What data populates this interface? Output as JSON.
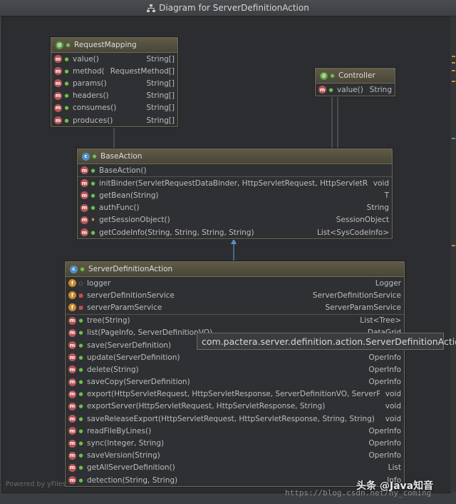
{
  "window": {
    "title": "Diagram for ServerDefinitionAction"
  },
  "classes": {
    "request_mapping": {
      "name": "RequestMapping",
      "kind_icon": "annotation-icon",
      "methods": [
        {
          "name": "value()",
          "type": "String[]"
        },
        {
          "name": "method()",
          "type": "RequestMethod[]"
        },
        {
          "name": "params()",
          "type": "String[]"
        },
        {
          "name": "headers()",
          "type": "String[]"
        },
        {
          "name": "consumes()",
          "type": "String[]"
        },
        {
          "name": "produces()",
          "type": "String[]"
        }
      ]
    },
    "controller": {
      "name": "Controller",
      "kind_icon": "annotation-icon",
      "methods": [
        {
          "name": "value()",
          "type": "String"
        }
      ]
    },
    "base_action": {
      "name": "BaseAction",
      "kind_icon": "class-icon",
      "constructors": [
        {
          "name": "BaseAction()",
          "type": ""
        }
      ],
      "methods": [
        {
          "name": "initBinder(ServletRequestDataBinder, HttpServletRequest, HttpServletResponse)",
          "type": "void",
          "vis": "pub"
        },
        {
          "name": "getBean(String)",
          "type": "T",
          "vis": "pub"
        },
        {
          "name": "authFunc()",
          "type": "String",
          "vis": "pub"
        },
        {
          "name": "getSessionObject()",
          "type": "SessionObject",
          "vis": "pro"
        },
        {
          "name": "getCodeInfo(String, String, String, String)",
          "type": "List<SysCodeInfo>",
          "vis": "pub"
        }
      ]
    },
    "server_definition_action": {
      "name": "ServerDefinitionAction",
      "kind_icon": "class-icon",
      "fields": [
        {
          "name": "logger",
          "type": "Logger",
          "vis": "pkg"
        },
        {
          "name": "serverDefinitionService",
          "type": "ServerDefinitionService",
          "vis": "pri"
        },
        {
          "name": "serverParamService",
          "type": "ServerParamService",
          "vis": "pri"
        }
      ],
      "methods": [
        {
          "name": "tree(String)",
          "type": "List<Tree>"
        },
        {
          "name": "list(PageInfo, ServerDefinitionVO)",
          "type": "DataGrid"
        },
        {
          "name": "save(ServerDefinition)",
          "type": "OperInfo"
        },
        {
          "name": "update(ServerDefinition)",
          "type": "OperInfo"
        },
        {
          "name": "delete(String)",
          "type": "OperInfo"
        },
        {
          "name": "saveCopy(ServerDefinition)",
          "type": "OperInfo"
        },
        {
          "name": "export(HttpServletRequest, HttpServletResponse, ServerDefinitionVO, ServerParamVO)",
          "type": "void"
        },
        {
          "name": "exportServer(HttpServletRequest, HttpServletResponse, String)",
          "type": "void"
        },
        {
          "name": "saveReleaseExport(HttpServletRequest, HttpServletResponse, String, String)",
          "type": "void"
        },
        {
          "name": "readFileByLines()",
          "type": "OperInfo"
        },
        {
          "name": "sync(Integer, String)",
          "type": "OperInfo"
        },
        {
          "name": "saveVersion(String)",
          "type": "OperInfo"
        },
        {
          "name": "getAllServerDefinition()",
          "type": "List"
        },
        {
          "name": "detection(String, String)",
          "type": "Info"
        }
      ]
    }
  },
  "tooltip": {
    "text": "com.pactera.server.definition.action.ServerDefinitionAction"
  },
  "footer": {
    "text": "Powered by yFiles"
  },
  "watermark": {
    "url": "https://blog.csdn.net/hy_coming",
    "brand": "头条 @Java知音"
  },
  "colors": {
    "method_icon": "#b85555",
    "field_icon": "#c98c2c",
    "class_icon": "#4f8fc6",
    "annotation_icon": "#5e9a3c",
    "inheritance_edge": "#5b8fc7"
  }
}
